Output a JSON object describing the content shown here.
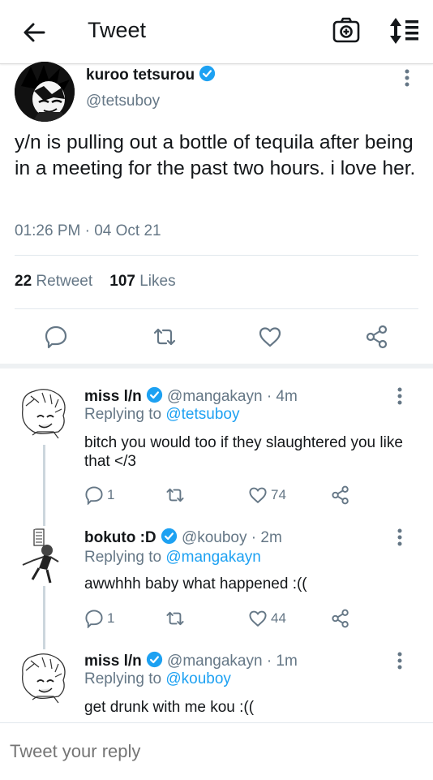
{
  "header": {
    "title": "Tweet",
    "back_icon": "arrow-left-icon",
    "camera_icon": "camera-icon",
    "sort_icon": "sort-icon"
  },
  "main_tweet": {
    "display_name": "kuroo tetsurou",
    "handle": "@tetsuboy",
    "text": "y/n is pulling out a bottle of tequila after being in a meeting for the past two hours. i love her.",
    "timestamp": "01:26 PM · 04 Oct 21",
    "retweet_count": "22",
    "retweet_label": "Retweet",
    "likes_count": "107",
    "likes_label": "Likes"
  },
  "replies": [
    {
      "display_name": "miss l/n",
      "handle": "@mangakayn · 4m",
      "replying_prefix": "Replying to",
      "replying_to": "@tetsuboy",
      "text": "bitch you would too if they slaughtered you like that </3",
      "reply_count": "1",
      "retweet_count": "",
      "like_count": "74"
    },
    {
      "display_name": "bokuto :D",
      "handle": "@kouboy · 2m",
      "replying_prefix": "Replying to",
      "replying_to": "@mangakayn",
      "text": "awwhhh baby what happened :((",
      "reply_count": "1",
      "retweet_count": "",
      "like_count": "44"
    },
    {
      "display_name": "miss l/n",
      "handle": "@mangakayn · 1m",
      "replying_prefix": "Replying to",
      "replying_to": "@kouboy",
      "text": "get drunk with me kou :(("
    }
  ],
  "reply_box": {
    "placeholder": "Tweet your reply"
  },
  "colors": {
    "accent": "#1da1f2",
    "secondary_text": "#657786",
    "text": "#14171a"
  }
}
